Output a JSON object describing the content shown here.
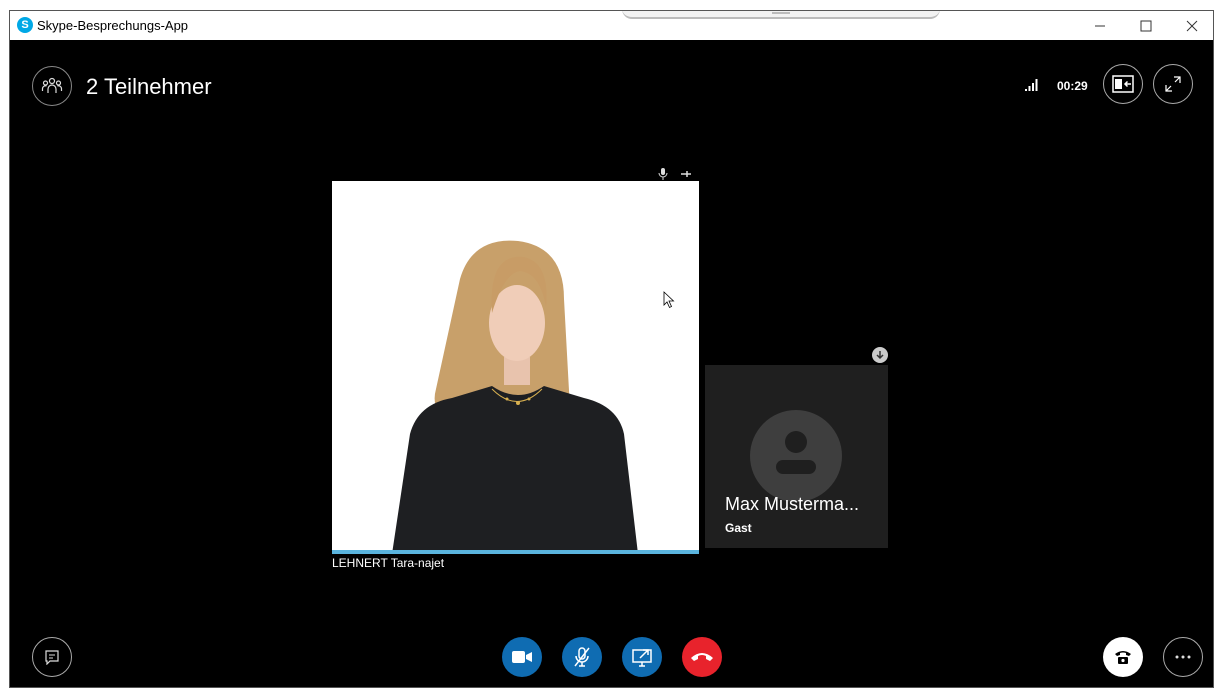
{
  "window": {
    "title": "Skype-Besprechungs-App"
  },
  "header": {
    "participants_label": "2 Teilnehmer",
    "timer": "00:29"
  },
  "main_video": {
    "name": "LEHNERT Tara-najet"
  },
  "side_tile": {
    "name": "Max Musterma...",
    "role": "Gast"
  },
  "colors": {
    "accent_blue": "#0f6cb2",
    "speaking": "#5ab4de",
    "hangup": "#e8232c",
    "skype": "#00a8e6"
  },
  "icons": [
    "skype-icon",
    "minimize-icon",
    "maximize-icon",
    "close-icon",
    "participants-icon",
    "signal-icon",
    "pip-icon",
    "fullscreen-icon",
    "mic-icon",
    "pin-icon",
    "download-icon",
    "avatar-icon",
    "chat-icon",
    "video-icon",
    "mic-off-icon",
    "share-screen-icon",
    "hangup-icon",
    "phone-icon",
    "more-icon"
  ]
}
